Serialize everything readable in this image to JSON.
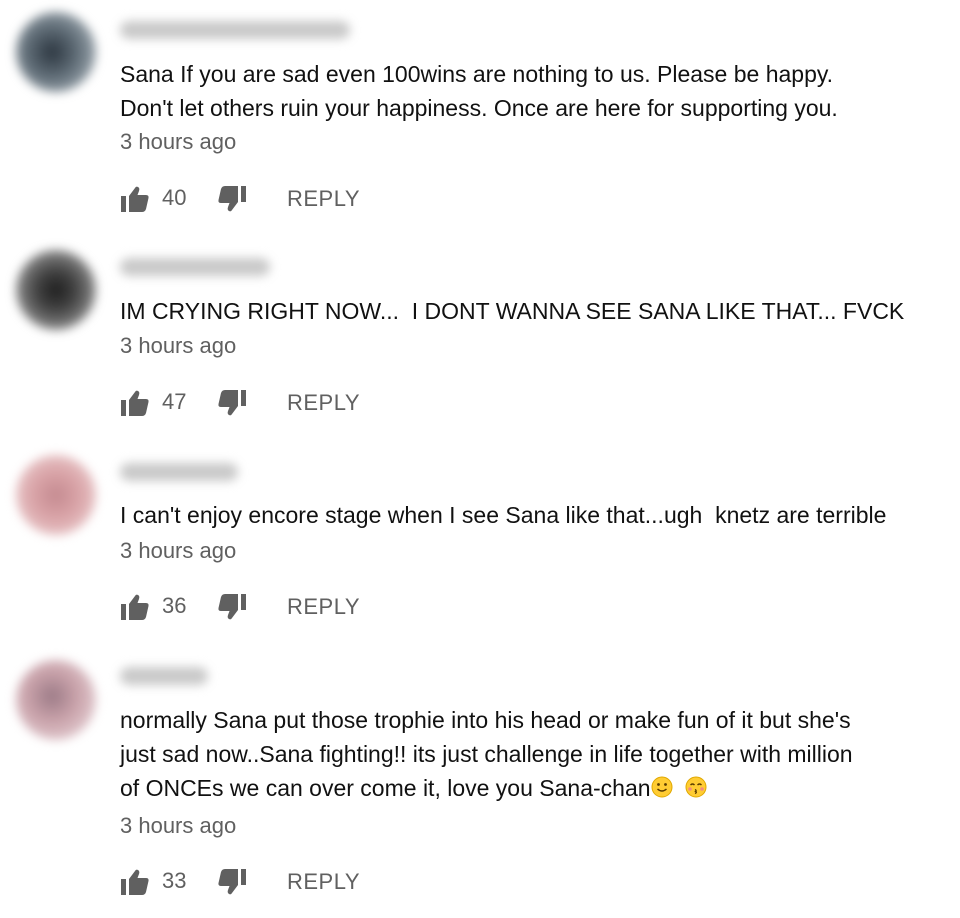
{
  "comments": [
    {
      "text": "Sana If you are sad even 100wins are nothing to us. Please be happy.\nDon't let others ruin your happiness. Once are here for supporting you.",
      "time": "3 hours ago",
      "likes": "40",
      "reply_label": "REPLY",
      "avatar_color": "#5d6a74"
    },
    {
      "text": "IM CRYING RIGHT NOW...  I DONT WANNA SEE SANA LIKE THAT... FVCK",
      "time": "3 hours ago",
      "likes": "47",
      "reply_label": "REPLY",
      "avatar_color": "#4a4a4a"
    },
    {
      "text": "I can't enjoy encore stage when I see Sana like that...ugh  knetz are terrible",
      "time": "3 hours ago",
      "likes": "36",
      "reply_label": "REPLY",
      "avatar_color": "#d9a3a7"
    },
    {
      "text_before_emoji": "normally Sana put those trophie into his head or make fun of it but she's\njust sad now..Sana fighting!! its just challenge in life together with million\nof ONCEs we can over come it, love you Sana-chan",
      "time": "3 hours ago",
      "likes": "33",
      "reply_label": "REPLY",
      "avatar_color": "#c9a2aa"
    }
  ],
  "icons": {
    "like": "thumbs-up-icon",
    "dislike": "thumbs-down-icon",
    "emoji_1": "slightly-smiling-face-icon",
    "emoji_2": "kissing-face-closed-eyes-icon"
  },
  "colors": {
    "text": "#111111",
    "meta": "#606060"
  }
}
